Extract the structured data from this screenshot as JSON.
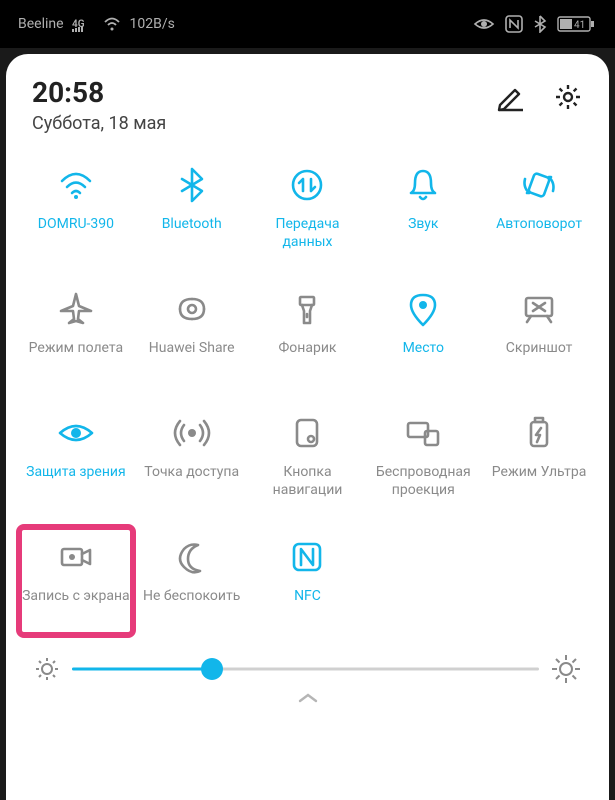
{
  "status_bar": {
    "carrier": "Beeline",
    "signal_type": "4G",
    "data_rate": "102B/s",
    "battery_percent": "41"
  },
  "header": {
    "time": "20:58",
    "date": "Суббота, 18 мая"
  },
  "tiles": [
    {
      "id": "wifi",
      "label": "DOMRU-390",
      "active": true,
      "icon": "wifi"
    },
    {
      "id": "bluetooth",
      "label": "Bluetooth",
      "active": true,
      "icon": "bluetooth"
    },
    {
      "id": "mobile-data",
      "label": "Передача данных",
      "active": true,
      "icon": "data-transfer"
    },
    {
      "id": "sound",
      "label": "Звук",
      "active": true,
      "icon": "bell"
    },
    {
      "id": "auto-rotate",
      "label": "Автоповорот",
      "active": true,
      "icon": "rotate"
    },
    {
      "id": "airplane",
      "label": "Режим полета",
      "active": false,
      "icon": "airplane"
    },
    {
      "id": "huawei-share",
      "label": "Huawei Share",
      "active": false,
      "icon": "share"
    },
    {
      "id": "flashlight",
      "label": "Фонарик",
      "active": false,
      "icon": "flashlight"
    },
    {
      "id": "location",
      "label": "Место",
      "active": true,
      "icon": "location"
    },
    {
      "id": "screenshot",
      "label": "Скриншот",
      "active": false,
      "icon": "screenshot"
    },
    {
      "id": "eye-comfort",
      "label": "Защита зрения",
      "active": true,
      "icon": "eye"
    },
    {
      "id": "hotspot",
      "label": "Точка доступа",
      "active": false,
      "icon": "hotspot"
    },
    {
      "id": "nav-dock",
      "label": "Кнопка навигации",
      "active": false,
      "icon": "nav-button"
    },
    {
      "id": "wireless-proj",
      "label": "Беспроводная проекция",
      "active": false,
      "icon": "projection"
    },
    {
      "id": "ultra-mode",
      "label": "Режим Ультра",
      "active": false,
      "icon": "battery-ultra"
    },
    {
      "id": "screen-record",
      "label": "Запись с экрана",
      "active": false,
      "icon": "screen-record",
      "highlight": true
    },
    {
      "id": "dnd",
      "label": "Не беспокоить",
      "active": false,
      "icon": "moon"
    },
    {
      "id": "nfc",
      "label": "NFC",
      "active": true,
      "icon": "nfc"
    }
  ],
  "brightness": {
    "value": 30
  }
}
